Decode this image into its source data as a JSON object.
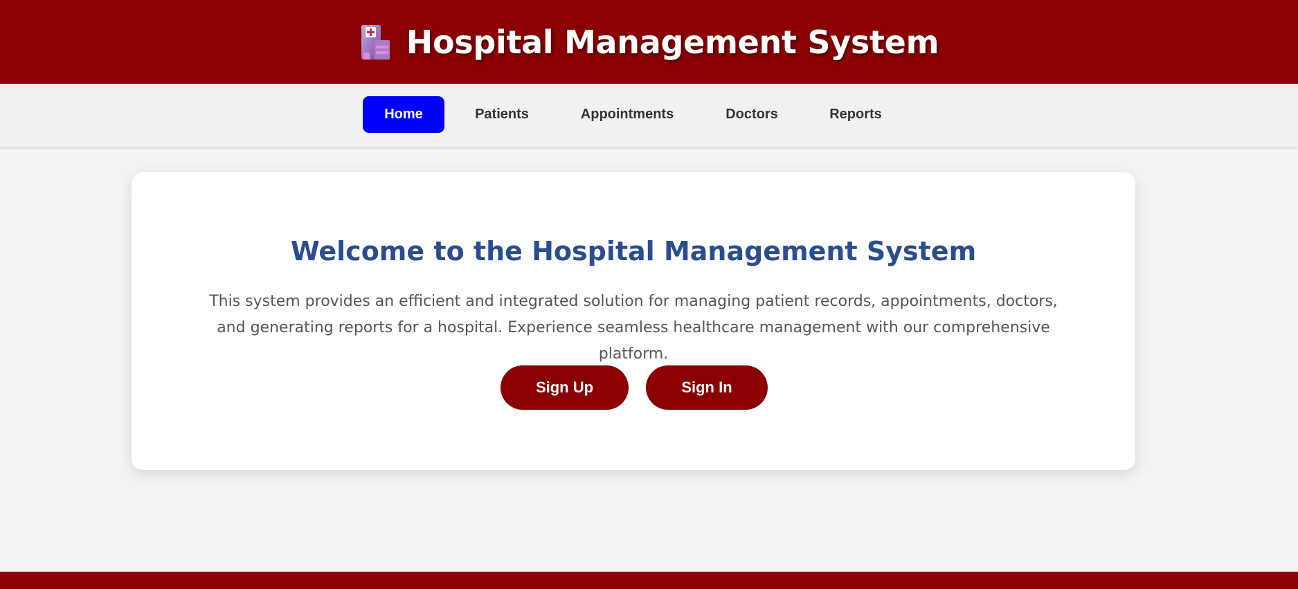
{
  "header": {
    "title": "Hospital Management System",
    "logo_icon": "hospital-building-icon"
  },
  "nav": {
    "items": [
      {
        "label": "Home",
        "active": true
      },
      {
        "label": "Patients",
        "active": false
      },
      {
        "label": "Appointments",
        "active": false
      },
      {
        "label": "Doctors",
        "active": false
      },
      {
        "label": "Reports",
        "active": false
      }
    ]
  },
  "main": {
    "welcome_title": "Welcome to the Hospital Management System",
    "intro_text": "This system provides an efficient and integrated solution for managing patient records, appointments, doctors, and generating reports for a hospital. Experience seamless healthcare management with our comprehensive platform.",
    "signup_label": "Sign Up",
    "signin_label": "Sign In"
  },
  "colors": {
    "brand": "#8b0000",
    "active_nav": "#0000ff",
    "heading": "#2a4d8f",
    "page_bg": "#f4f4f4"
  }
}
